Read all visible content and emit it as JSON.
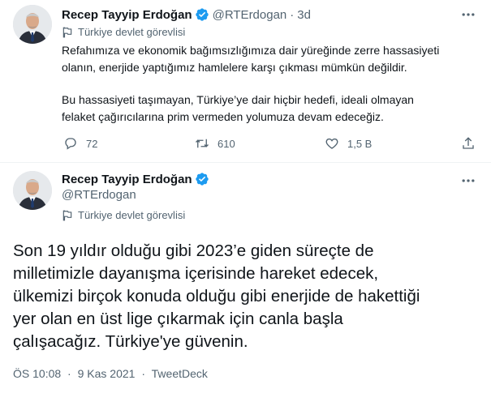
{
  "tweet1": {
    "author_name": "Recep Tayyip Erdoğan",
    "handle": "@RTErdogan",
    "separator": "·",
    "time": "3d",
    "label": "Türkiye devlet görevlisi",
    "body_lines": [
      "Refahımıza ve ekonomik bağımsızlığımıza dair yüreğinde zerre hassasiyeti",
      "olanın, enerjide yaptığımız hamlelere karşı çıkması mümkün değildir.",
      "Bu hassasiyeti taşımayan, Türkiye’ye dair hiçbir hedefi, ideali olmayan",
      "felaket çağırıcılarına prim vermeden yolumuza devam edeceğiz."
    ],
    "actions": {
      "reply_count": "72",
      "retweet_count": "610",
      "like_count": "1,5 B"
    }
  },
  "tweet2": {
    "author_name": "Recep Tayyip Erdoğan",
    "handle": "@RTErdogan",
    "label": "Türkiye devlet görevlisi",
    "body_lines": [
      "Son 19 yıldır olduğu gibi 2023’e giden süreçte de",
      "milletimizle dayanışma içerisinde hareket edecek,",
      "ülkemizi birçok konuda olduğu gibi enerjide de hakettiği",
      "yer olan en üst lige çıkarmak için canla başla",
      "çalışacağız. Türkiye'ye güvenin."
    ],
    "time": "ÖS 10:08",
    "date": "9 Kas 2021",
    "separator": "·",
    "source": "TweetDeck"
  },
  "colors": {
    "text_primary": "#0f1419",
    "text_secondary": "#536471",
    "verified_blue": "#1d9bf0",
    "divider": "#eff3f4"
  },
  "icons": {
    "verified": "verified-badge-icon",
    "more": "more-options-icon",
    "label": "flag-icon",
    "reply": "reply-icon",
    "retweet": "retweet-icon",
    "like": "heart-icon",
    "share": "share-icon"
  }
}
